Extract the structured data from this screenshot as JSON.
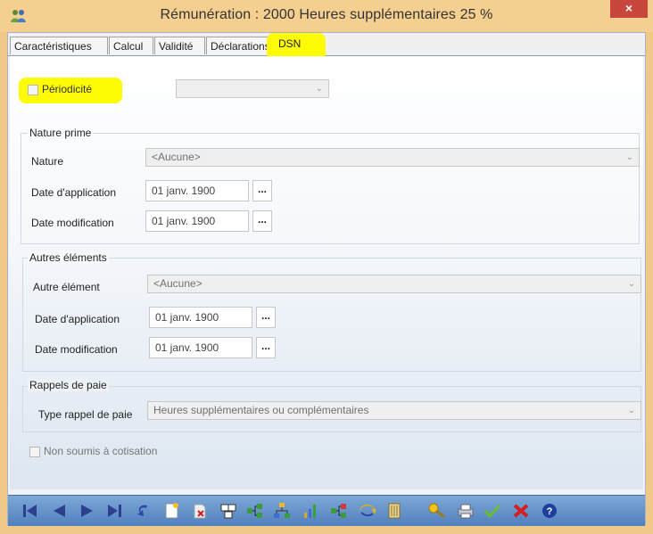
{
  "window": {
    "title": "Rémunération  : 2000 Heures supplémentaires 25 %",
    "close_label": "×"
  },
  "tabs": [
    {
      "label": "Caractéristiques",
      "active": false
    },
    {
      "label": "Calcul",
      "active": false
    },
    {
      "label": "Validité",
      "active": false
    },
    {
      "label": "Déclarations",
      "active": false
    },
    {
      "label": "DSN",
      "active": true
    }
  ],
  "periodicite": {
    "label": "Périodicité",
    "checked": false,
    "value": ""
  },
  "nature_prime": {
    "title": "Nature prime",
    "nature_label": "Nature",
    "nature_value": "<Aucune>",
    "date_application_label": "Date d'application",
    "date_application_value": "01 janv. 1900",
    "date_modification_label": "Date modification",
    "date_modification_value": "01 janv. 1900",
    "dots": "..."
  },
  "autres_elements": {
    "title": "Autres éléments",
    "autre_element_label": "Autre élément",
    "autre_element_value": "<Aucune>",
    "date_application_label": "Date d'application",
    "date_application_value": "01 janv. 1900",
    "date_modification_label": "Date modification",
    "date_modification_value": "01 janv. 1900",
    "dots": "..."
  },
  "rappels_de_paie": {
    "title": "Rappels de paie",
    "type_label": "Type rappel de paie",
    "type_value": "Heures supplémentaires ou complémentaires"
  },
  "non_soumis": {
    "label": "Non soumis à cotisation",
    "checked": false
  },
  "toolbar_icons": [
    "first-record-icon",
    "previous-record-icon",
    "next-record-icon",
    "last-record-icon",
    "undo-icon",
    "new-document-icon",
    "delete-document-icon",
    "copy-icon",
    "tree-add-icon",
    "hierarchy-icon",
    "chart-add-icon",
    "tree-link-icon",
    "import-icon",
    "archive-icon",
    "search-key-icon",
    "print-icon",
    "validate-icon",
    "cancel-icon",
    "help-icon"
  ],
  "colors": {
    "highlight": "#fdfc05",
    "titlebar": "#f4cf8f",
    "toolbar": "#5b8ac6"
  }
}
